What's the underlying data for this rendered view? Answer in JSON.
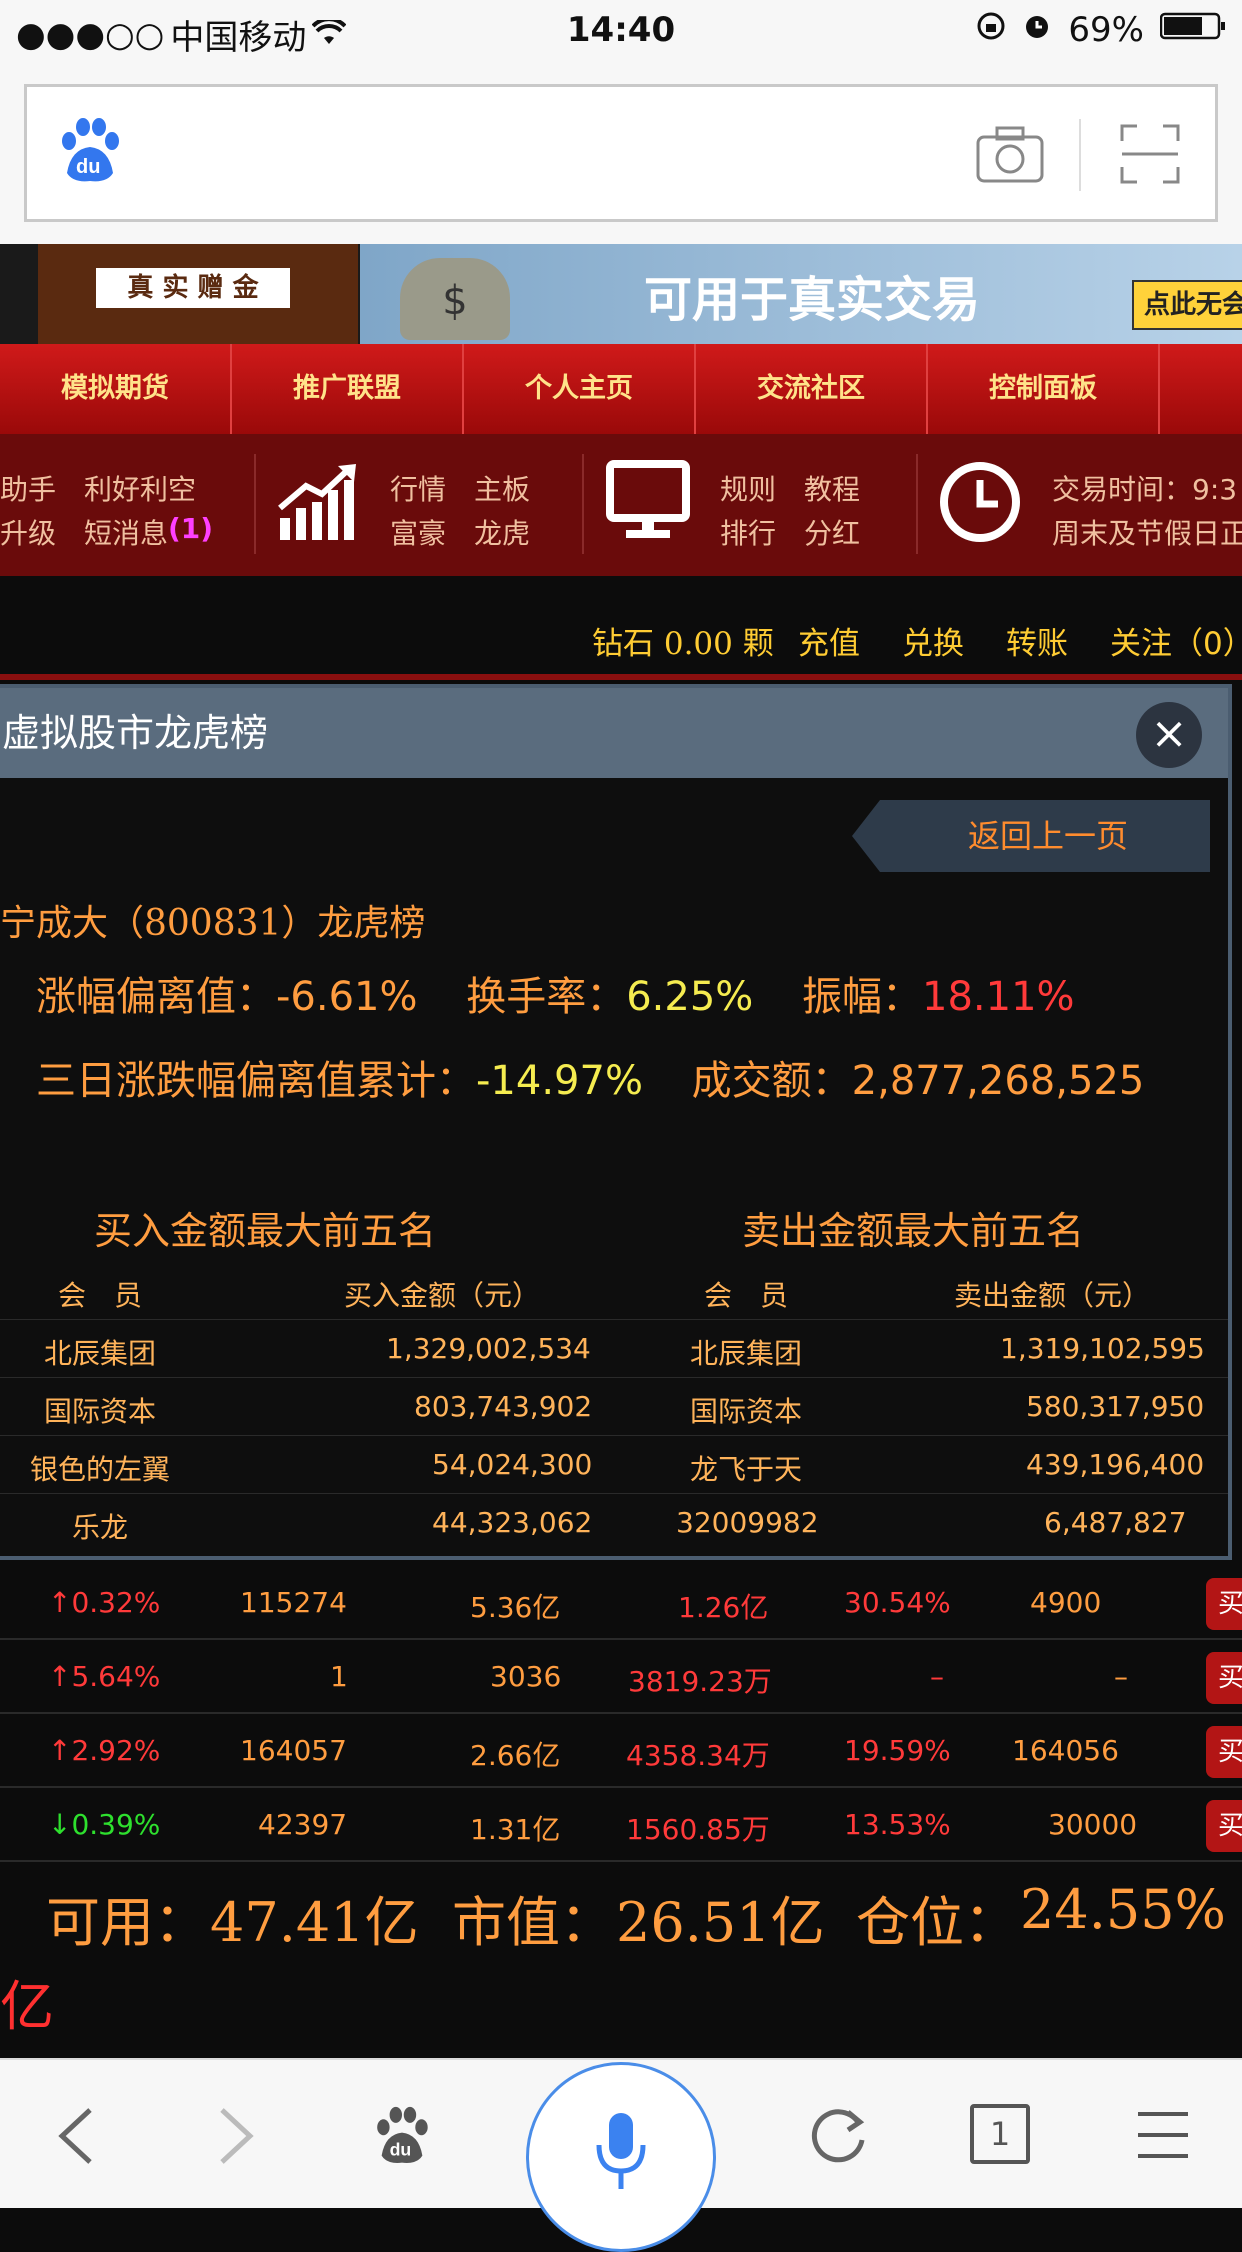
{
  "status": {
    "carrier": "中国移动",
    "time": "14:40",
    "battery": "69%"
  },
  "banner": {
    "badge": "真 实 赠 金",
    "headline": "可用于真实交易",
    "cta": "点此无会"
  },
  "nav": [
    "模拟期货",
    "推广联盟",
    "个人主页",
    "交流社区",
    "控制面板"
  ],
  "subnav": {
    "col1": [
      "助手",
      "利好利空",
      "升级",
      "短消息",
      "(1)"
    ],
    "col2": [
      "行情",
      "主板",
      "富豪",
      "龙虎"
    ],
    "col3": [
      "规则",
      "教程",
      "排行",
      "分红"
    ],
    "col4": [
      "交易时间：9:3",
      "周末及节假日正"
    ]
  },
  "goldbar": [
    "钻石 0.00 颗",
    "充值",
    "兑换",
    "转账",
    "关注（0）"
  ],
  "modal": {
    "title": "虚拟股市龙虎榜",
    "back": "返回上一页",
    "stock_title": "宁成大（800831）龙虎榜",
    "dev_label": "涨幅偏离值：",
    "dev_value": "-6.61%",
    "turnover_label": "换手率：",
    "turnover_value": "6.25%",
    "amp_label": "振幅：",
    "amp_value": "18.11%",
    "cum_label": "三日涨跌幅偏离值累计：",
    "cum_value": "-14.97%",
    "vol_label": "成交额：",
    "vol_value": "2,877,268,525",
    "buy_title": "买入金额最大前五名",
    "sell_title": "卖出金额最大前五名",
    "headers": [
      "会　员",
      "买入金额（元）",
      "会　员",
      "卖出金额（元）"
    ],
    "rows": [
      [
        "北辰集团",
        "1,329,002,534",
        "北辰集团",
        "1,319,102,595"
      ],
      [
        "国际资本",
        "803,743,902",
        "国际资本",
        "580,317,950"
      ],
      [
        "银色的左翼",
        "54,024,300",
        "龙飞于天",
        "439,196,400"
      ],
      [
        "乐龙",
        "44,323,062",
        "32009982",
        "6,487,827"
      ]
    ]
  },
  "table2": [
    {
      "chg": "↑0.32%",
      "dir": "up",
      "a": "115274",
      "b": "5.36亿",
      "c": "1.26亿",
      "d": "30.54%",
      "e": "4900",
      "btn": "买"
    },
    {
      "chg": "↑5.64%",
      "dir": "up",
      "a": "1",
      "b": "3036",
      "c": "3819.23万",
      "d": "–",
      "e": "–",
      "btn": "买"
    },
    {
      "chg": "↑2.92%",
      "dir": "up",
      "a": "164057",
      "b": "2.66亿",
      "c": "4358.34万",
      "d": "19.59%",
      "e": "164056",
      "btn": "买"
    },
    {
      "chg": "↓0.39%",
      "dir": "down",
      "a": "42397",
      "b": "1.31亿",
      "c": "1560.85万",
      "d": "13.53%",
      "e": "30000",
      "btn": "买"
    }
  ],
  "summary": {
    "avail_label": "可用：",
    "avail": "47.41亿",
    "mv_label": "市值：",
    "mv": "26.51亿",
    "pos_label": "仓位：",
    "pos": "24.55%",
    "extra": "亿"
  },
  "bottom": {
    "tabs": "1"
  }
}
